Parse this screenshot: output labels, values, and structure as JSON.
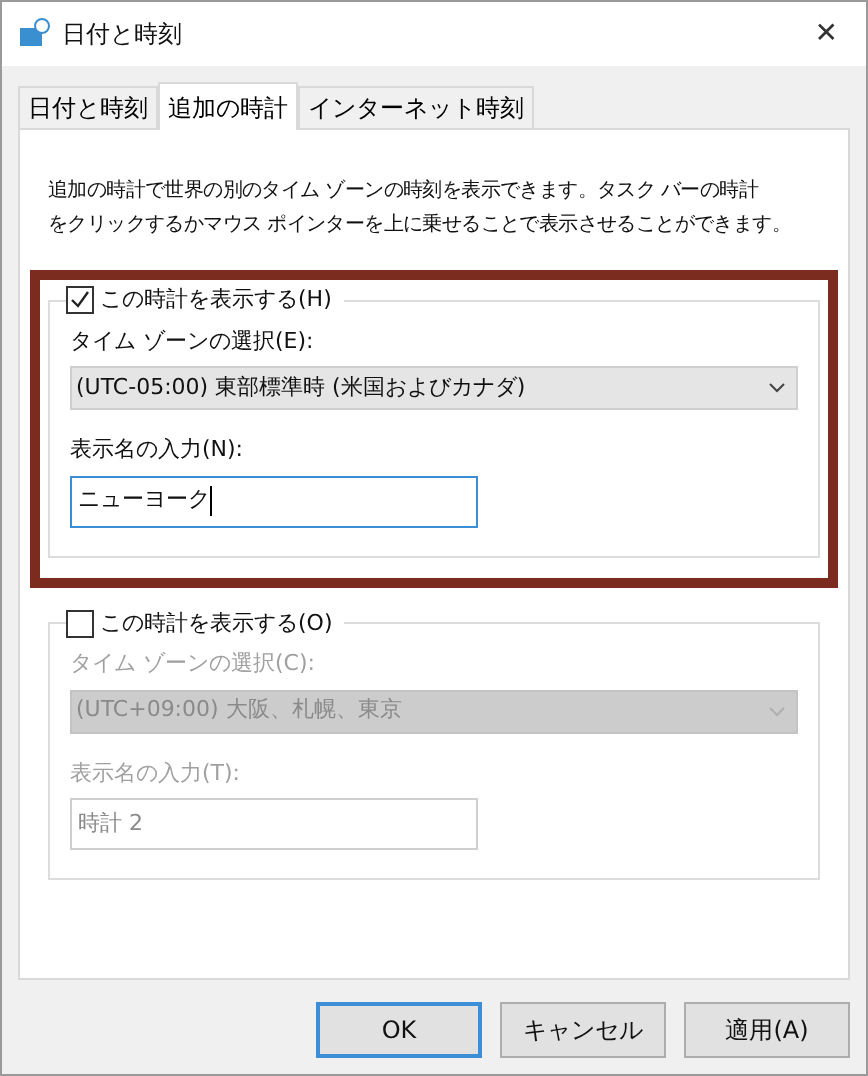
{
  "window": {
    "title": "日付と時刻",
    "close": "✕"
  },
  "tabs": [
    {
      "label": "日付と時刻",
      "selected": false
    },
    {
      "label": "追加の時計",
      "selected": true
    },
    {
      "label": "インターネット時刻",
      "selected": false
    }
  ],
  "description": [
    "追加の時計で世界の別のタイム ゾーンの時刻を表示できます。タスク バーの時計",
    "をクリックするかマウス ポインターを上に乗せることで表示させることができます。"
  ],
  "clocks": [
    {
      "checkbox_label": "この時計を表示する(H)",
      "checked": true,
      "highlighted": true,
      "timezone_label": "タイム ゾーンの選択(E):",
      "timezone": "(UTC-05:00) 東部標準時 (米国およびカナダ)",
      "name_label": "表示名の入力(N):",
      "name": "ニューヨーク",
      "focused": true
    },
    {
      "checkbox_label": "この時計を表示する(O)",
      "checked": false,
      "highlighted": false,
      "timezone_label": "タイム ゾーンの選択(C):",
      "timezone": "(UTC+09:00) 大阪、札幌、東京",
      "name_label": "表示名の入力(T):",
      "name": "時計 2",
      "focused": false
    }
  ],
  "buttons": [
    {
      "label": "OK",
      "default": true
    },
    {
      "label": "キャンセル",
      "default": false
    },
    {
      "label": "適用(A)",
      "default": false
    }
  ]
}
